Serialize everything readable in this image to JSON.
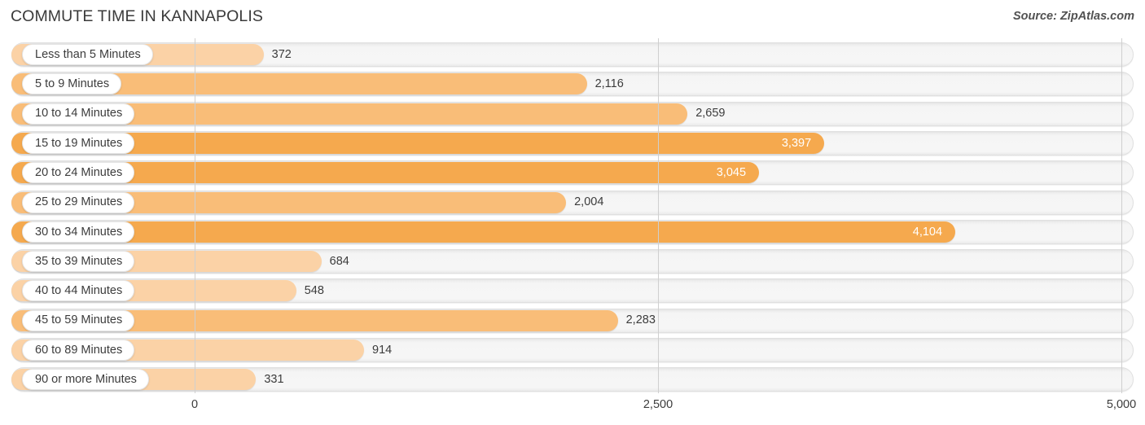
{
  "header": {
    "title": "COMMUTE TIME IN KANNAPOLIS",
    "source": "Source: ZipAtlas.com"
  },
  "colors": {
    "bar_strong": "#f5a94e",
    "bar_mid": "#f9bd78",
    "bar_light": "#fbd2a6",
    "track": "#f5f5f5",
    "gridline": "#cfcfcf",
    "text": "#3c3c3c",
    "value_inside": "#ffffff"
  },
  "axis": {
    "ticks": [
      {
        "label": "0",
        "value": 0
      },
      {
        "label": "2,500",
        "value": 2500
      },
      {
        "label": "5,000",
        "value": 5000
      }
    ],
    "min": 0,
    "max": 5000
  },
  "chart_data": {
    "type": "bar",
    "orientation": "horizontal",
    "title": "COMMUTE TIME IN KANNAPOLIS",
    "xlabel": "",
    "ylabel": "",
    "xlim": [
      0,
      5000
    ],
    "grid": true,
    "legend": false,
    "source": "Source: ZipAtlas.com",
    "categories": [
      "Less than 5 Minutes",
      "5 to 9 Minutes",
      "10 to 14 Minutes",
      "15 to 19 Minutes",
      "20 to 24 Minutes",
      "25 to 29 Minutes",
      "30 to 34 Minutes",
      "35 to 39 Minutes",
      "40 to 44 Minutes",
      "45 to 59 Minutes",
      "60 to 89 Minutes",
      "90 or more Minutes"
    ],
    "values": [
      372,
      2116,
      2659,
      3397,
      3045,
      2004,
      4104,
      684,
      548,
      2283,
      914,
      331
    ],
    "value_labels": [
      "372",
      "2,116",
      "2,659",
      "3,397",
      "3,045",
      "2,004",
      "4,104",
      "684",
      "548",
      "2,283",
      "914",
      "331"
    ]
  },
  "rows": [
    {
      "label": "Less than 5 Minutes",
      "value": 372,
      "value_label": "372",
      "label_inside": false,
      "shade": "light"
    },
    {
      "label": "5 to 9 Minutes",
      "value": 2116,
      "value_label": "2,116",
      "label_inside": false,
      "shade": "mid"
    },
    {
      "label": "10 to 14 Minutes",
      "value": 2659,
      "value_label": "2,659",
      "label_inside": false,
      "shade": "mid"
    },
    {
      "label": "15 to 19 Minutes",
      "value": 3397,
      "value_label": "3,397",
      "label_inside": true,
      "shade": "strong"
    },
    {
      "label": "20 to 24 Minutes",
      "value": 3045,
      "value_label": "3,045",
      "label_inside": true,
      "shade": "strong"
    },
    {
      "label": "25 to 29 Minutes",
      "value": 2004,
      "value_label": "2,004",
      "label_inside": false,
      "shade": "mid"
    },
    {
      "label": "30 to 34 Minutes",
      "value": 4104,
      "value_label": "4,104",
      "label_inside": true,
      "shade": "strong"
    },
    {
      "label": "35 to 39 Minutes",
      "value": 684,
      "value_label": "684",
      "label_inside": false,
      "shade": "light"
    },
    {
      "label": "40 to 44 Minutes",
      "value": 548,
      "value_label": "548",
      "label_inside": false,
      "shade": "light"
    },
    {
      "label": "45 to 59 Minutes",
      "value": 2283,
      "value_label": "2,283",
      "label_inside": false,
      "shade": "mid"
    },
    {
      "label": "60 to 89 Minutes",
      "value": 914,
      "value_label": "914",
      "label_inside": false,
      "shade": "light"
    },
    {
      "label": "90 or more Minutes",
      "value": 331,
      "value_label": "331",
      "label_inside": false,
      "shade": "light"
    }
  ]
}
